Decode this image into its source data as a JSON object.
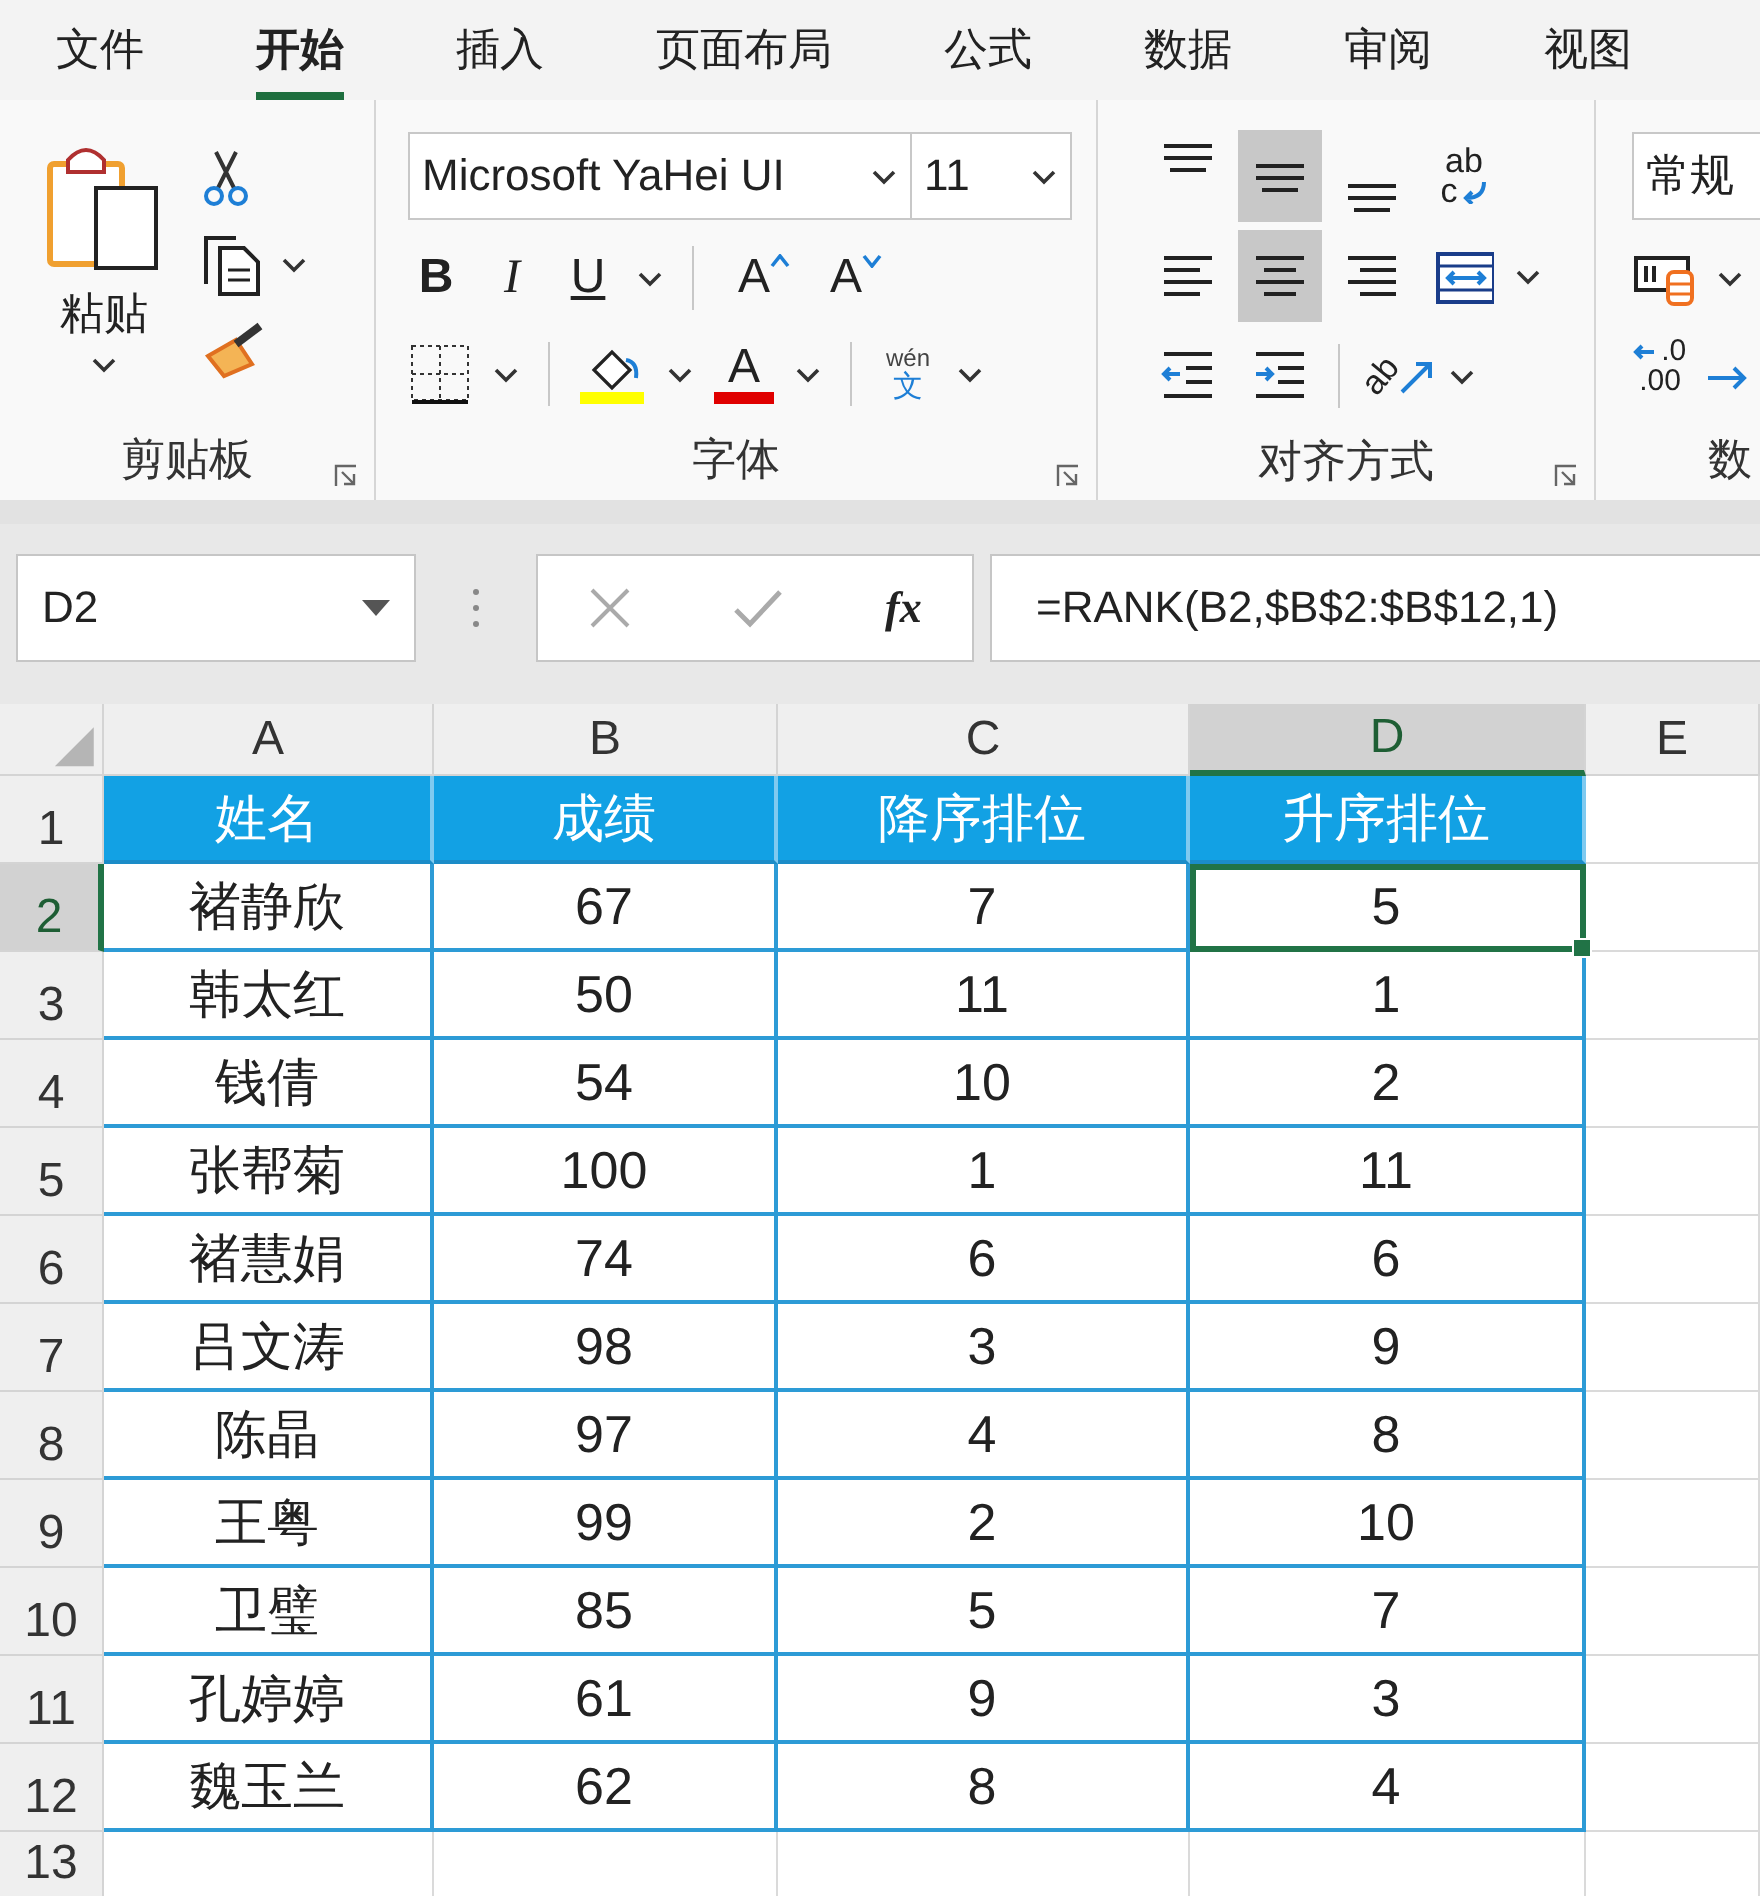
{
  "tabs": [
    {
      "label": "文件",
      "selected": false
    },
    {
      "label": "开始",
      "selected": true
    },
    {
      "label": "插入",
      "selected": false
    },
    {
      "label": "页面布局",
      "selected": false
    },
    {
      "label": "公式",
      "selected": false
    },
    {
      "label": "数据",
      "selected": false
    },
    {
      "label": "审阅",
      "selected": false
    },
    {
      "label": "视图",
      "selected": false
    }
  ],
  "clipboard": {
    "label": "剪贴板",
    "paste": "粘贴"
  },
  "font": {
    "label": "字体",
    "font_name": "Microsoft YaHei UI",
    "font_size": "11",
    "bold": "B",
    "italic": "I",
    "underline": "U",
    "grow": "A",
    "shrink": "A",
    "font_color_letter": "A",
    "phonetic_top": "wén",
    "phonetic_bottom": "文"
  },
  "alignment": {
    "label": "对齐方式",
    "rows": [
      [
        {
          "kind": "top",
          "selected": false
        },
        {
          "kind": "middle",
          "selected": true
        },
        {
          "kind": "bottom",
          "selected": false
        },
        {
          "kind": "wrap",
          "selected": false,
          "glyph_top": "ab",
          "glyph_bottom": "c"
        }
      ],
      [
        {
          "kind": "left",
          "selected": false
        },
        {
          "kind": "center",
          "selected": true
        },
        {
          "kind": "right",
          "selected": false
        },
        {
          "kind": "merge",
          "selected": false
        }
      ],
      [
        {
          "kind": "outdent",
          "selected": false
        },
        {
          "kind": "indent",
          "selected": false
        },
        {
          "kind": "orientation",
          "selected": false,
          "glyph_top": "ab"
        }
      ]
    ]
  },
  "number": {
    "label": "数",
    "format": "常规",
    "decrease_top": ".0",
    "decrease_bottom": ".00"
  },
  "formula_bar": {
    "name_box": "D2",
    "function_glyph": "fx",
    "formula": "=RANK(B2,$B$2:$B$12,1)"
  },
  "grid": {
    "columns": [
      {
        "label": "A",
        "selected": false
      },
      {
        "label": "B",
        "selected": false
      },
      {
        "label": "C",
        "selected": false
      },
      {
        "label": "D",
        "selected": true
      },
      {
        "label": "E",
        "selected": false
      }
    ],
    "rows": [
      {
        "number": "1",
        "selected": false,
        "kind": "header",
        "cells": [
          "姓名",
          "成绩",
          "降序排位",
          "升序排位"
        ]
      },
      {
        "number": "2",
        "selected": true,
        "kind": "data",
        "cells": [
          "褚静欣",
          "67",
          "7",
          "5"
        ]
      },
      {
        "number": "3",
        "selected": false,
        "kind": "data",
        "cells": [
          "韩太红",
          "50",
          "11",
          "1"
        ]
      },
      {
        "number": "4",
        "selected": false,
        "kind": "data",
        "cells": [
          "钱倩",
          "54",
          "10",
          "2"
        ]
      },
      {
        "number": "5",
        "selected": false,
        "kind": "data",
        "cells": [
          "张帮菊",
          "100",
          "1",
          "11"
        ]
      },
      {
        "number": "6",
        "selected": false,
        "kind": "data",
        "cells": [
          "褚慧娟",
          "74",
          "6",
          "6"
        ]
      },
      {
        "number": "7",
        "selected": false,
        "kind": "data",
        "cells": [
          "吕文涛",
          "98",
          "3",
          "9"
        ]
      },
      {
        "number": "8",
        "selected": false,
        "kind": "data",
        "cells": [
          "陈晶",
          "97",
          "4",
          "8"
        ]
      },
      {
        "number": "9",
        "selected": false,
        "kind": "data",
        "cells": [
          "王粤",
          "99",
          "2",
          "10"
        ]
      },
      {
        "number": "10",
        "selected": false,
        "kind": "data",
        "cells": [
          "卫璧",
          "85",
          "5",
          "7"
        ]
      },
      {
        "number": "11",
        "selected": false,
        "kind": "data",
        "cells": [
          "孔婷婷",
          "61",
          "9",
          "3"
        ]
      },
      {
        "number": "12",
        "selected": false,
        "kind": "data",
        "cells": [
          "魏玉兰",
          "62",
          "8",
          "4"
        ]
      },
      {
        "number": "13",
        "selected": false,
        "kind": "blank"
      }
    ]
  }
}
